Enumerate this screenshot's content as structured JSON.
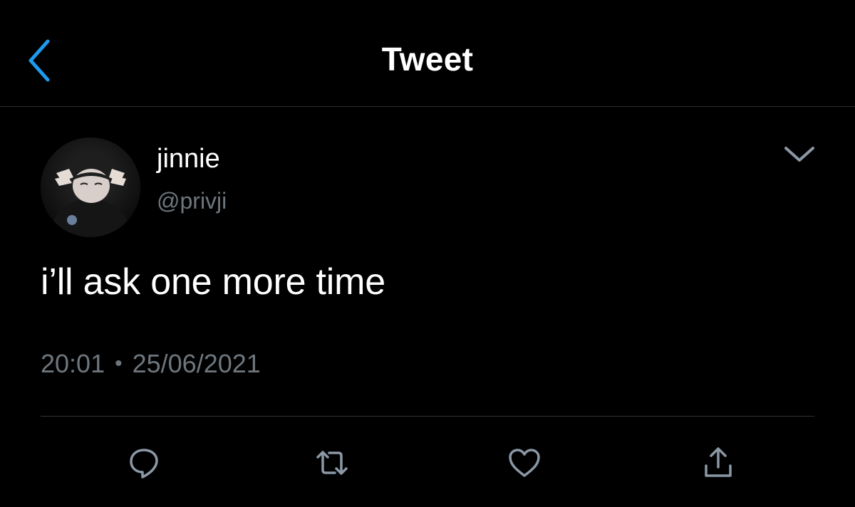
{
  "header": {
    "title": "Tweet",
    "back_icon": "chevron-left-icon"
  },
  "tweet": {
    "author": {
      "display_name": "jinnie",
      "handle": "@privji"
    },
    "text": "i’ll ask one more time",
    "time": "20:01",
    "separator": "•",
    "date": "25/06/2021"
  },
  "actions": [
    {
      "name": "reply",
      "icon": "reply-icon"
    },
    {
      "name": "retweet",
      "icon": "retweet-icon"
    },
    {
      "name": "like",
      "icon": "heart-icon"
    },
    {
      "name": "share",
      "icon": "share-icon"
    }
  ],
  "colors": {
    "background": "#000000",
    "accent": "#1d9bf0",
    "secondary_text": "#6e767d",
    "icon": "#8b98a5"
  }
}
